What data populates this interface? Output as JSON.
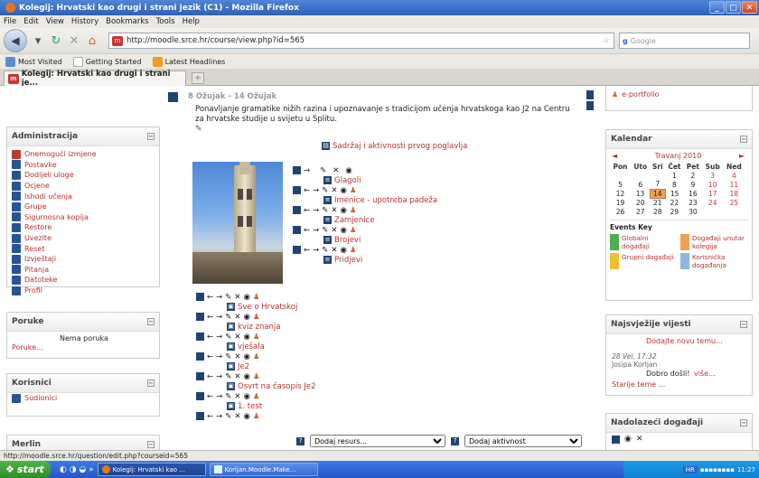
{
  "window": {
    "title": "Kolegij: Hrvatski kao drugi i strani jezik (C1) - Mozilla Firefox"
  },
  "menu": [
    "File",
    "Edit",
    "View",
    "History",
    "Bookmarks",
    "Tools",
    "Help"
  ],
  "nav": {
    "url": "http://moodle.srce.hr/course/view.php?id=565",
    "search_placeholder": "Google"
  },
  "bookmarks": [
    "Most Visited",
    "Getting Started",
    "Latest Headlines"
  ],
  "tab": {
    "label": "Kolegij: Hrvatski kao drugi i strani je..."
  },
  "admin": {
    "title": "Administracija",
    "items": [
      "Onemogući izmjene",
      "Postavke",
      "Dodijeli uloge",
      "Ocjene",
      "Ishodi učenja",
      "Grupe",
      "Sigurnosna kopija",
      "Restore",
      "Uvezite",
      "Reset",
      "Izvještaji",
      "Pitanja",
      "Datoteke",
      "Profil"
    ],
    "colors": [
      "#c0392b",
      "#2a5298",
      "#2a5298",
      "#2a5298",
      "#2a5298",
      "#2a5298",
      "#2a5298",
      "#2a5298",
      "#2a5298",
      "#2a5298",
      "#2a5298",
      "#2a5298",
      "#2a5298",
      "#2a5298"
    ]
  },
  "messages": {
    "title": "Poruke",
    "link": "Poruke...",
    "empty": "Nema poruka"
  },
  "users": {
    "title": "Korisnici",
    "link": "Sudionici"
  },
  "merlin": {
    "title": "Merlin"
  },
  "section": {
    "date": "8 Ožujak - 14 Ožujak",
    "desc": "Ponavljanje gramatike nižih razina i upoznavanje s tradicijom učenja hrvatskoga kao J2 na Centru za hrvatske studije u svijetu u Splitu.",
    "first_link": "Sadržaj i aktivnosti prvog poglavlja",
    "inner": [
      "Glagoli",
      "Imenice - upotreba padeža",
      "Zamjenice",
      "Brojevi",
      "Pridjevi"
    ],
    "outer": [
      "Sve o Hrvatskoj",
      "kviz znanja",
      "vješala",
      "Je2",
      "Osvrt na časopis Je2",
      "1. test"
    ]
  },
  "add": {
    "resource": "Dodaj resurs...",
    "activity": "Dodaj aktivnost"
  },
  "right_top": {
    "link": "e-portfolio"
  },
  "calendar": {
    "title": "Kalendar",
    "month": "Travanj 2010",
    "days": [
      "Pon",
      "Uto",
      "Sri",
      "Čet",
      "Pet",
      "Sub",
      "Ned"
    ],
    "weeks": [
      [
        "",
        "",
        "",
        "1",
        "2",
        "3",
        "4"
      ],
      [
        "5",
        "6",
        "7",
        "8",
        "9",
        "10",
        "11"
      ],
      [
        "12",
        "13",
        "14",
        "15",
        "16",
        "17",
        "18"
      ],
      [
        "19",
        "20",
        "21",
        "22",
        "23",
        "24",
        "25"
      ],
      [
        "26",
        "27",
        "28",
        "29",
        "30",
        "",
        ""
      ]
    ],
    "today": "14",
    "events_key_title": "Events Key",
    "keys": [
      {
        "label": "Globalni događaji",
        "color": "#4caf50"
      },
      {
        "label": "Događaji unutar kolegija",
        "color": "#f0a050"
      },
      {
        "label": "Grupni događaji",
        "color": "#f0c030"
      },
      {
        "label": "Korisnička događanja",
        "color": "#8fb7dc"
      }
    ]
  },
  "news": {
    "title": "Najsvježije vijesti",
    "add": "Dodajte novu temu...",
    "date": "28 Vel, 17:32",
    "author": "Josipa Korljan",
    "text": "Dobro došli!",
    "more": "više...",
    "older": "Starije teme ..."
  },
  "upcoming": {
    "title": "Nadolazeći događaji"
  },
  "status": {
    "text": "http://moodle.srce.hr/question/edit.php?courseid=565"
  },
  "taskbar": {
    "start": "start",
    "items": [
      "Kolegij: Hrvatski kao ...",
      "Korljan.Moodle.Make..."
    ],
    "lang": "HR",
    "time": "11:27"
  }
}
